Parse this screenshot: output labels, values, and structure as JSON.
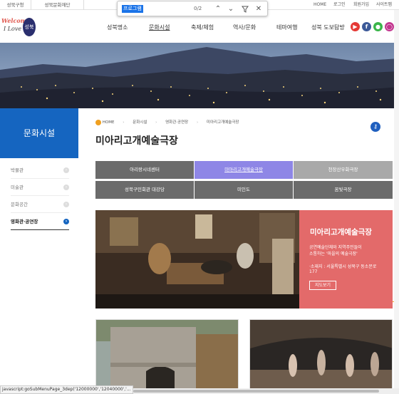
{
  "topbar": {
    "tab1": "성북구청",
    "tab2": "성북문화재단",
    "util": [
      "HOME",
      "로그인",
      "회원가입",
      "사이트맵"
    ]
  },
  "findbar": {
    "query": "프로그램",
    "count": "0/2"
  },
  "logo": {
    "line1": "Welcome!",
    "line2": "I Love",
    "mark": "성북"
  },
  "nav": [
    "성북명소",
    "문화시설",
    "축제/체험",
    "역사/문화",
    "테마여행",
    "성북 도보탐방"
  ],
  "social": [
    "youtube",
    "facebook",
    "line",
    "instagram"
  ],
  "sidebar": {
    "title": "문화시설",
    "items": [
      "박물관",
      "미술관",
      "문화공간",
      "영화관·공연장"
    ]
  },
  "breadcrumb": [
    "HOME",
    "문화시설",
    "영화관·공연장",
    "미아리고개예술극장"
  ],
  "page_title": "미아리고개예술극장",
  "grid": [
    [
      "아리랑시네센터",
      "미아리고개예술극장",
      "천장산우화극장"
    ],
    [
      "성북구민회관 대강당",
      "미인도",
      "꿈빛극장"
    ]
  ],
  "feature": {
    "title": "미아리고개예술극장",
    "desc1": "공연예술단체와 지역주민들이",
    "desc2": "소통하는 '마을의 예술극장'",
    "loc1": "·소재지 : 서울특별시 성북구 동소문로",
    "loc2": "177",
    "button": "지도보기"
  },
  "status": "javascript:goSubMenuPage_3dep('12000000','12040000','..."
}
